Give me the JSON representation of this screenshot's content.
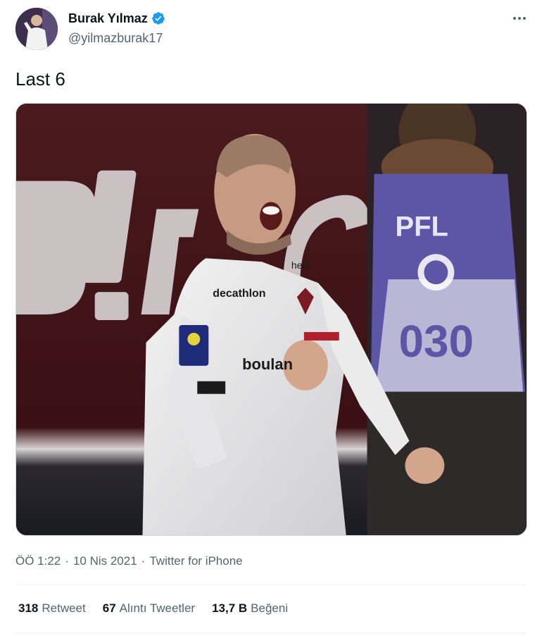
{
  "author": {
    "name": "Burak Yılmaz",
    "handle": "@yilmazburak17",
    "verified": true,
    "verified_color": "#1d9bf0"
  },
  "tweet": {
    "text": "Last 6"
  },
  "media": {
    "description_icon": "photo",
    "sign_text": "D!r C",
    "bib_number": "030",
    "shirt_sponsor": "boulan",
    "shirt_brand": "decathlon"
  },
  "meta": {
    "time": "ÖÖ 1:22",
    "separator": "·",
    "date": "10 Nis 2021",
    "source": "Twitter for iPhone"
  },
  "stats": {
    "retweets": {
      "count": "318",
      "label": "Retweet"
    },
    "quotes": {
      "count": "67",
      "label": "Alıntı Tweetler"
    },
    "likes": {
      "count": "13,7 B",
      "label": "Beğeni"
    }
  }
}
